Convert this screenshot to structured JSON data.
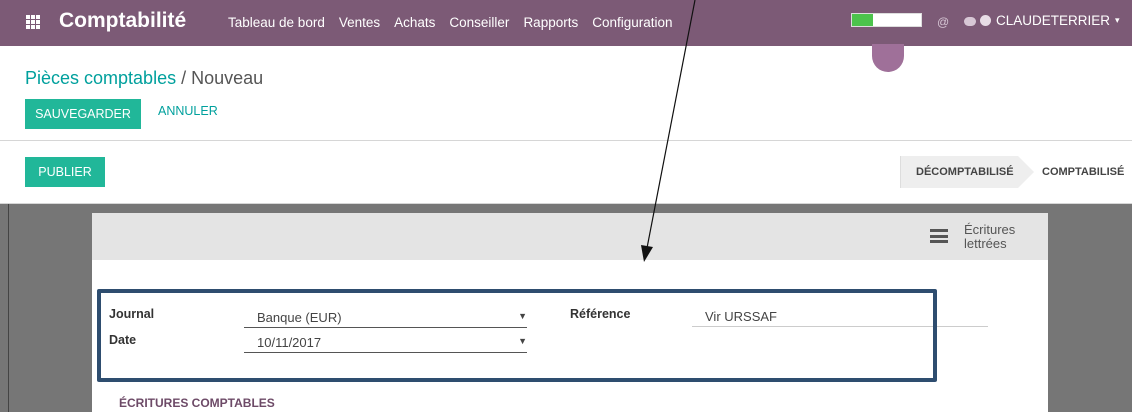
{
  "topbar": {
    "app_title": "Comptabilité",
    "menu": [
      "Tableau de bord",
      "Ventes",
      "Achats",
      "Conseiller",
      "Rapports",
      "Configuration"
    ],
    "user_name": "CLAUDETERRIER",
    "progress_fraction": 0.3,
    "colors": {
      "bar": "#7c5a76",
      "progress": "#4cc34c"
    }
  },
  "header": {
    "breadcrumb_parent": "Pièces comptables",
    "breadcrumb_separator": "/",
    "breadcrumb_current": "Nouveau",
    "save_label": "SAUVEGARDER",
    "cancel_label": "ANNULER"
  },
  "statusbar": {
    "publish_label": "PUBLIER",
    "states": [
      "DÉCOMPTABILISÉ",
      "COMPTABILISÉ"
    ],
    "active_state": "DÉCOMPTABILISÉ"
  },
  "sheet": {
    "reconciled_line1": "Écritures",
    "reconciled_line2": "lettrées",
    "journal_label": "Journal",
    "journal_value": "Banque (EUR)",
    "date_label": "Date",
    "date_value": "10/11/2017",
    "reference_label": "Référence",
    "reference_value": "Vir URSSAF",
    "section_title": "ÉCRITURES COMPTABLES"
  },
  "accent": "#21b799"
}
